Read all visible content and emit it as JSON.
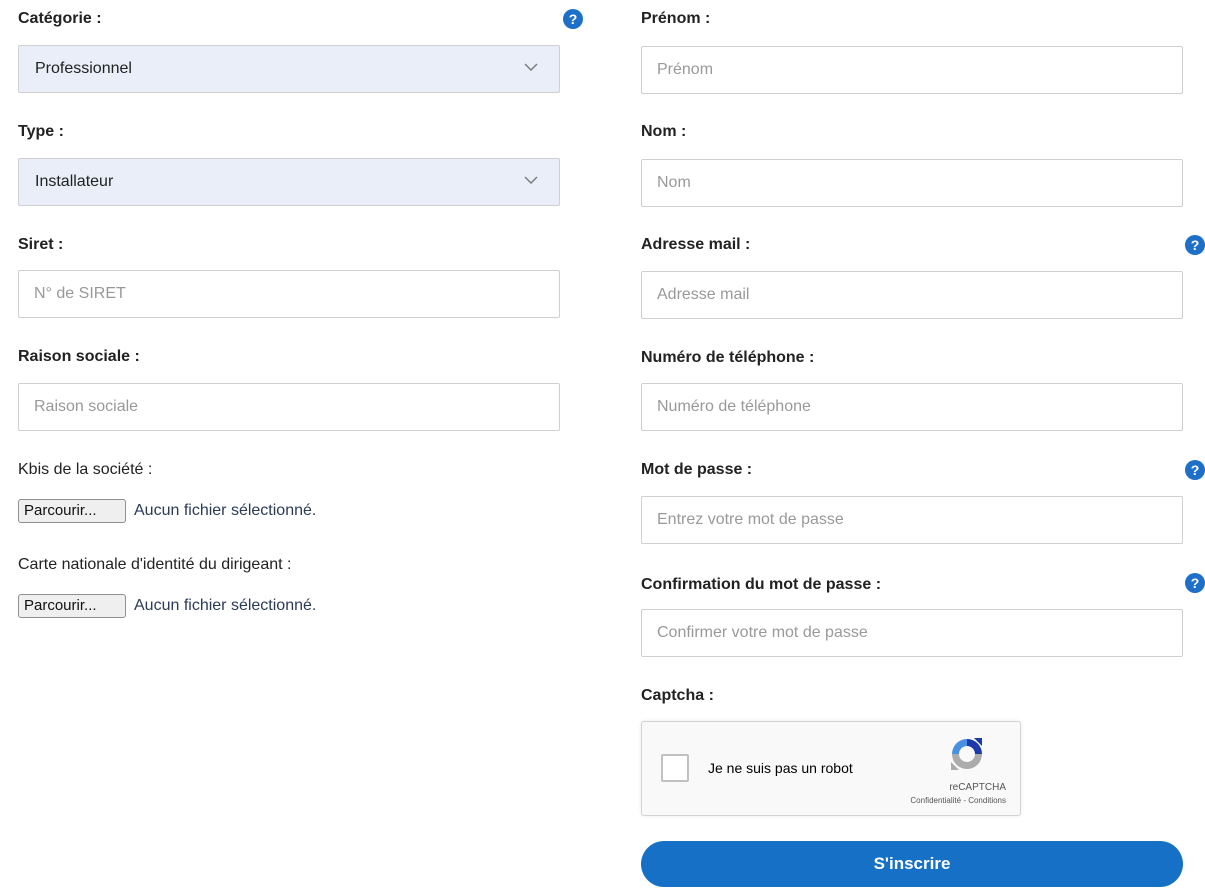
{
  "left": {
    "categorie": {
      "label": "Catégorie :",
      "value": "Professionnel"
    },
    "type": {
      "label": "Type  :",
      "value": "Installateur"
    },
    "siret": {
      "label": "Siret :",
      "placeholder": "N° de SIRET"
    },
    "raison": {
      "label": "Raison sociale :",
      "placeholder": "Raison sociale"
    },
    "kbis": {
      "label": "Kbis de la société :",
      "button": "Parcourir...",
      "status": "Aucun fichier sélectionné."
    },
    "cni": {
      "label": "Carte nationale d'identité du dirigeant :",
      "button": "Parcourir...",
      "status": "Aucun fichier sélectionné."
    }
  },
  "right": {
    "prenom": {
      "label": "Prénom :",
      "placeholder": "Prénom"
    },
    "nom": {
      "label": "Nom :",
      "placeholder": "Nom"
    },
    "email": {
      "label": "Adresse mail :",
      "placeholder": "Adresse mail"
    },
    "tel": {
      "label": "Numéro de téléphone :",
      "placeholder": "Numéro de téléphone"
    },
    "password": {
      "label": "Mot de passe :",
      "placeholder": "Entrez votre mot de passe"
    },
    "confirm": {
      "label": "Confirmation du mot de passe :",
      "placeholder": "Confirmer votre mot de passe"
    },
    "captcha": {
      "label": "Captcha :",
      "checkbox_label": "Je ne suis pas un robot",
      "brand": "reCAPTCHA",
      "links": "Confidentialité - Conditions"
    },
    "submit": "S'inscrire"
  },
  "help_glyph": "?",
  "colors": {
    "accent": "#1671c6",
    "help": "#1d6fc8",
    "select_bg": "#e9eef8"
  },
  "icons": {
    "help": "question-circle-icon",
    "select": "chevron-down-icon",
    "captcha": "recaptcha-logo-icon"
  }
}
